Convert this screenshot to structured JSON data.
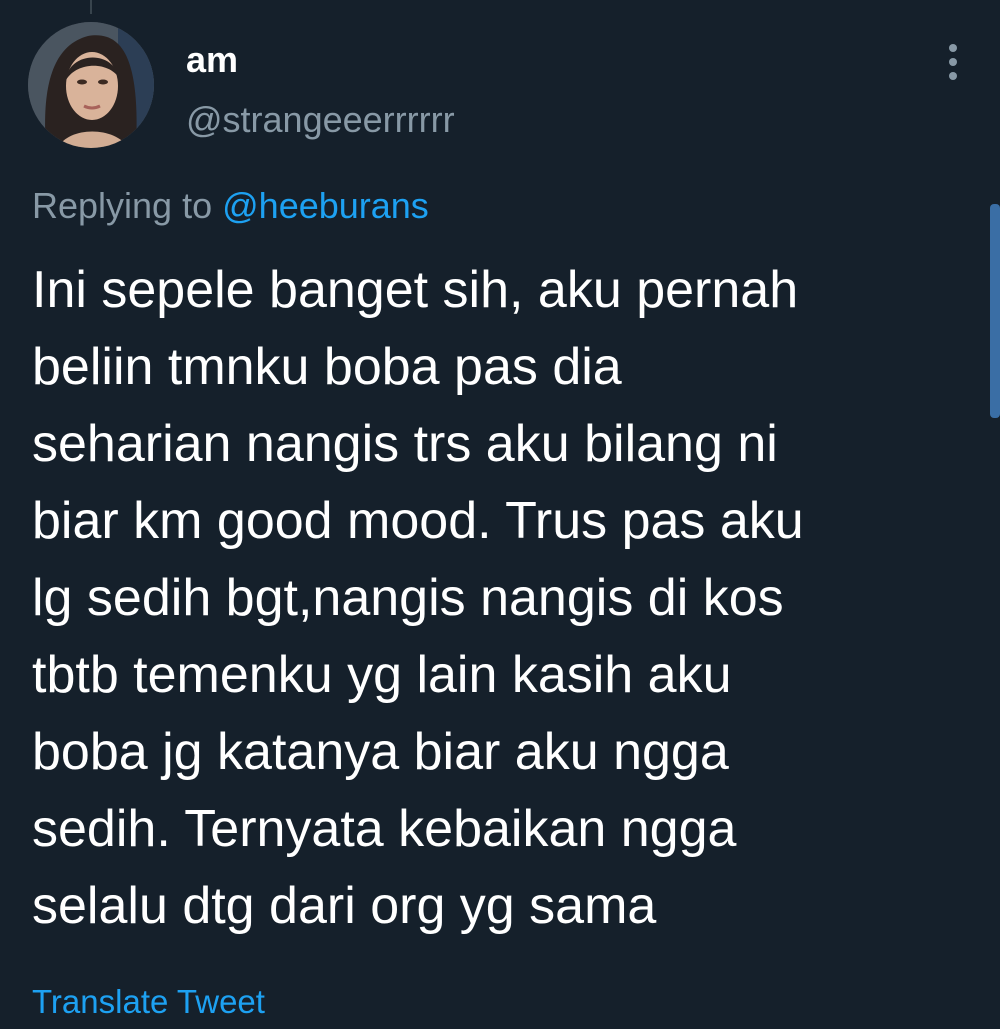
{
  "tweet": {
    "display_name": "am",
    "handle": "@strangeeerrrrrr",
    "reply_prefix": "Replying to",
    "reply_to": "@heeburans",
    "text_lines": [
      "Ini sepele banget sih, aku pernah",
      "beliin tmnku boba pas dia",
      "seharian nangis trs aku bilang ni",
      "biar km good mood. Trus pas aku",
      "lg sedih bgt,nangis nangis di kos",
      "tbtb temenku yg lain kasih aku",
      "boba jg katanya biar aku ngga",
      "sedih. Ternyata kebaikan ngga",
      "selalu dtg dari org yg sama"
    ],
    "translate_label": "Translate Tweet"
  },
  "icons": {
    "avatar": "profile-photo",
    "more": "vertical-ellipsis-icon"
  },
  "colors": {
    "background": "#15202b",
    "primary_text": "#ffffff",
    "secondary_text": "#8899a6",
    "link": "#1da1f2"
  }
}
